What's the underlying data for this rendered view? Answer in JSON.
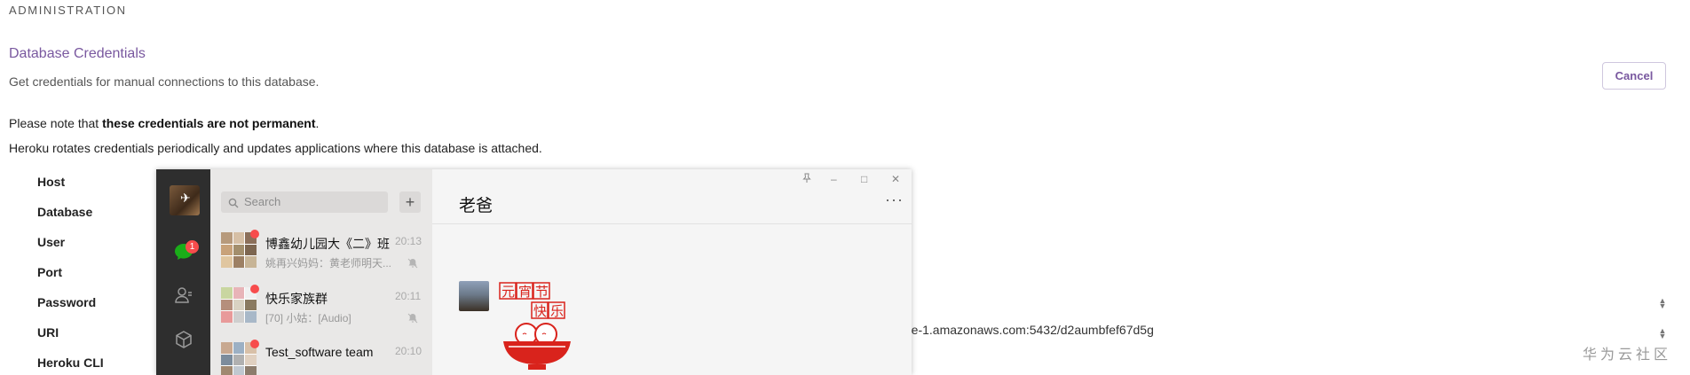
{
  "header": {
    "section_title": "ADMINISTRATION"
  },
  "panel": {
    "title": "Database Credentials",
    "description": "Get credentials for manual connections to this database.",
    "cancel_label": "Cancel",
    "note_prefix": "Please note that ",
    "note_bold": "these credentials are not permanent",
    "note_suffix": ".",
    "note_line2": "Heroku rotates credentials periodically and updates applications where this database is attached."
  },
  "credentials": {
    "labels": [
      "Host",
      "Database",
      "User",
      "Port",
      "Password",
      "URI",
      "Heroku CLI"
    ],
    "uri_visible_value": "ute-1.amazonaws.com:5432/d2aumbfef67d5g"
  },
  "watermark": "华为云社区",
  "wechat": {
    "search_placeholder": "Search",
    "plus_label": "+",
    "unread_badge": "1",
    "window_buttons": [
      "–",
      "□",
      "✕"
    ],
    "pin_icon": "pin-icon",
    "conversations": [
      {
        "name": "博鑫幼儿园大《二》班",
        "time": "20:13",
        "preview": "姚再兴妈妈：黄老师明天..."
      },
      {
        "name": "快乐家族群",
        "time": "20:11",
        "preview": "[70] 小姑：[Audio]"
      },
      {
        "name": "Test_software team",
        "time": "20:10",
        "preview": ""
      }
    ],
    "chat": {
      "title": "老爸",
      "more": "···",
      "sticker_text_1": "元宵节",
      "sticker_text_2": "快乐"
    }
  },
  "colors": {
    "accent": "#79589f",
    "wechat_nav": "#2e2e2e",
    "wechat_list": "#e9e8e7",
    "badge": "#f74c4c"
  }
}
